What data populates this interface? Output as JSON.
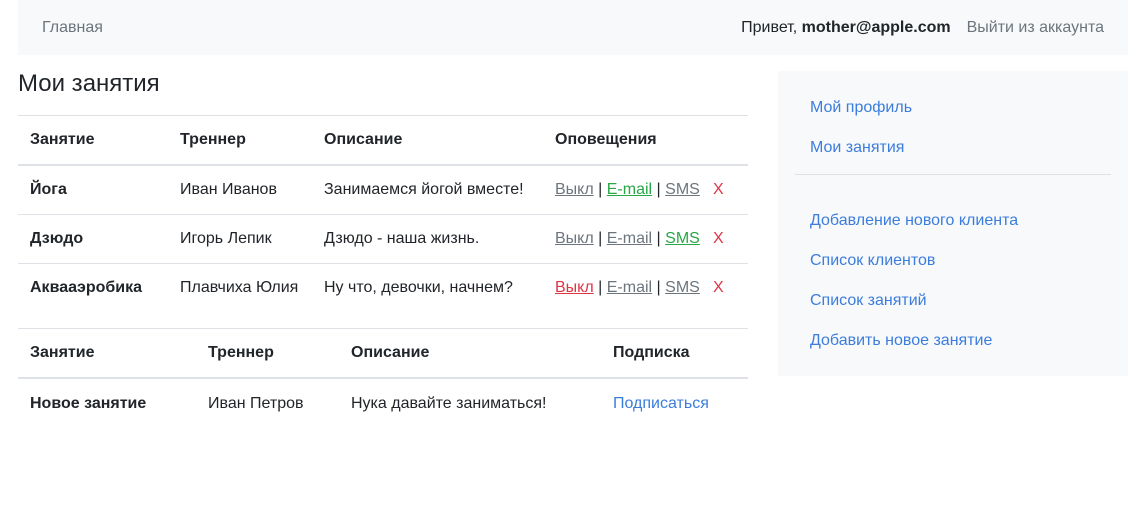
{
  "nav": {
    "home": "Главная",
    "greeting": "Привет,",
    "user": "mother@apple.com",
    "logout": "Выйти из аккаунта"
  },
  "page_title": "Мои занятия",
  "my_classes": {
    "headers": [
      "Занятие",
      "Треннер",
      "Описание",
      "Оповещения"
    ],
    "notify_labels": {
      "off": "Выкл",
      "email": "E-mail",
      "sms": "SMS",
      "sep": "|",
      "delete": "X"
    },
    "rows": [
      {
        "name": "Йога",
        "trainer": "Иван Иванов",
        "description": "Занимаемся йогой вместе!",
        "active": "email"
      },
      {
        "name": "Дзюдо",
        "trainer": "Игорь Лепик",
        "description": "Дзюдо - наша жизнь.",
        "active": "sms"
      },
      {
        "name": "Аквааэробика",
        "trainer": "Плавчиха Юлия",
        "description": "Ну что, девочки, начнем?",
        "active": "off"
      }
    ]
  },
  "available_classes": {
    "headers": [
      "Занятие",
      "Треннер",
      "Описание",
      "Подписка"
    ],
    "rows": [
      {
        "name": "Новое занятие",
        "trainer": "Иван Петров",
        "description": "Нука давайте заниматься!",
        "action": "Подписаться"
      }
    ]
  },
  "sidebar": {
    "group1": [
      "Мой профиль",
      "Мои занятия"
    ],
    "group2": [
      "Добавление нового клиента",
      "Список клиентов",
      "Список занятий",
      "Добавить новое занятие"
    ]
  },
  "colors": {
    "link": "#3b7ddd",
    "active_on": "#28a745",
    "active_off": "#dc3545",
    "muted": "#6c757d"
  }
}
